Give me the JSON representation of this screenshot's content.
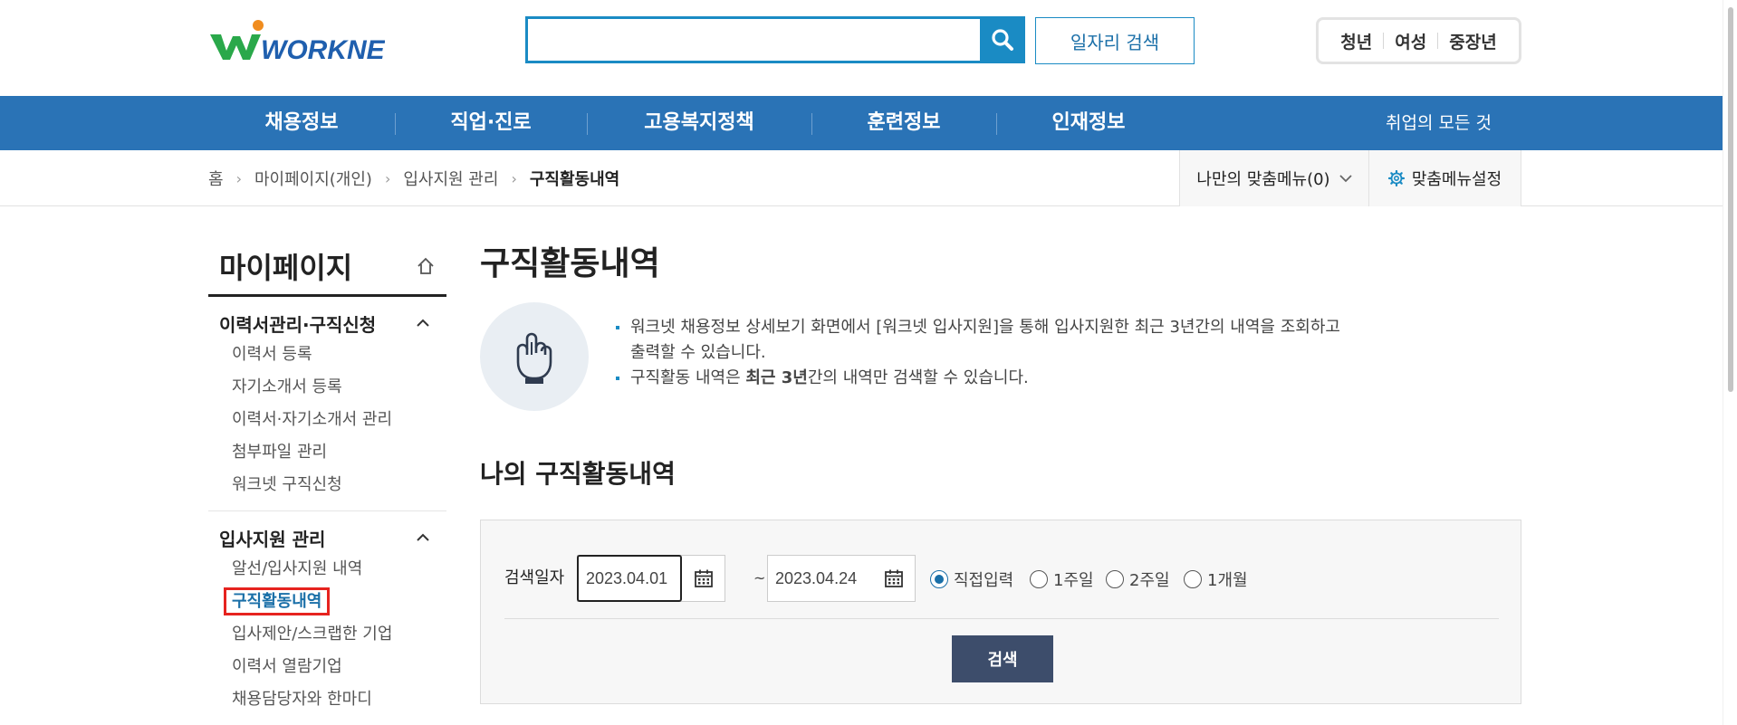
{
  "header": {
    "logo_text": "WORKNET",
    "search": {
      "value": "",
      "placeholder": ""
    },
    "job_search_label": "일자리 검색",
    "audience": [
      "청년",
      "여성",
      "중장년"
    ]
  },
  "gnb": {
    "items": [
      "채용정보",
      "직업·진로",
      "고용복지정책",
      "훈련정보",
      "인재정보"
    ],
    "all_label": "취업의 모든 것"
  },
  "breadcrumb": {
    "items": [
      "홈",
      "마이페이지(개인)",
      "입사지원 관리",
      "구직활동내역"
    ],
    "my_menu_label": "나만의 맞춤메뉴(0)",
    "menu_setting_label": "맞춤메뉴설정"
  },
  "sidebar": {
    "title": "마이페이지",
    "groups": [
      {
        "title": "이력서관리·구직신청",
        "items": [
          "이력서 등록",
          "자기소개서 등록",
          "이력서·자기소개서 관리",
          "첨부파일 관리",
          "워크넷 구직신청"
        ]
      },
      {
        "title": "입사지원 관리",
        "items": [
          "알선/입사지원 내역",
          "구직활동내역",
          "입사제안/스크랩한 기업",
          "이력서 열람기업",
          "채용담당자와 한마디"
        ]
      }
    ],
    "active_item": "구직활동내역"
  },
  "main": {
    "title": "구직활동내역",
    "info": {
      "line1": "워크넷 채용정보 상세보기 화면에서 [워크넷 입사지원]을 통해 입사지원한 최근 3년간의 내역을 조회하고",
      "line1_cont": "출력할 수 있습니다.",
      "line2_pre": "구직활동 내역은 ",
      "line2_bold": "최근 3년",
      "line2_post": "간의 내역만 검색할 수 있습니다."
    },
    "section_title": "나의 구직활동내역",
    "search_panel": {
      "label": "검색일자",
      "date_from": "2023.04.01",
      "tilde": "~",
      "date_to": "2023.04.24",
      "radios": [
        {
          "label": "직접입력",
          "checked": true
        },
        {
          "label": "1주일",
          "checked": false
        },
        {
          "label": "2주일",
          "checked": false
        },
        {
          "label": "1개월",
          "checked": false
        }
      ],
      "submit_label": "검색"
    }
  },
  "colors": {
    "brand_blue": "#2a73b6",
    "accent": "#1a8bc4",
    "button_dark": "#3d4d6b",
    "highlight_red": "#e6231f"
  }
}
